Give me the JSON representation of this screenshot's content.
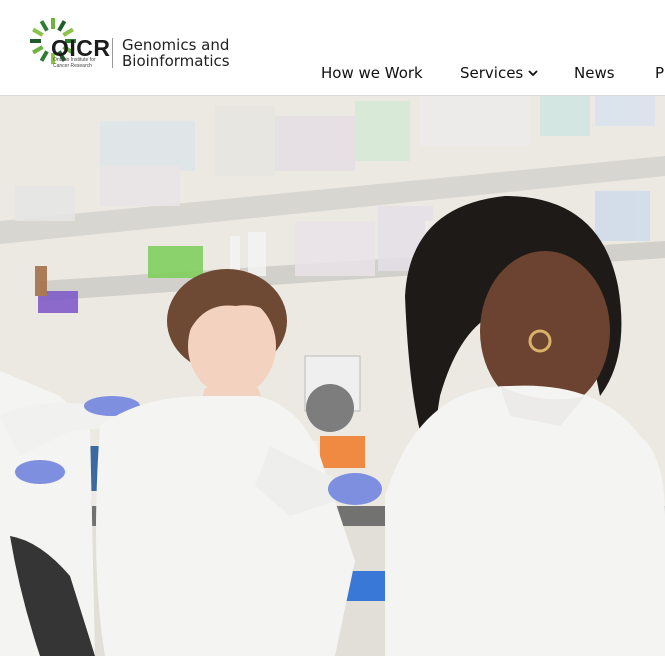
{
  "header": {
    "logo": {
      "text": "OICR",
      "subtitle": "Ontario Institute for Cancer Research",
      "mark_icon": "oicr-pinwheel-icon"
    },
    "brand_title": "Genomics and Bioinformatics"
  },
  "nav": {
    "items": [
      {
        "label": "How we Work"
      },
      {
        "label": "Services",
        "icon": "chevron-down-icon"
      },
      {
        "label": "News"
      },
      {
        "label": "P"
      }
    ]
  },
  "hero": {
    "image": "lab-researchers-photo"
  },
  "colors": {
    "logo_green": "#6cb33f",
    "logo_dark": "#1f5e2c",
    "lab_coat": "#f4f4f2",
    "glove": "#7f8fe0"
  }
}
